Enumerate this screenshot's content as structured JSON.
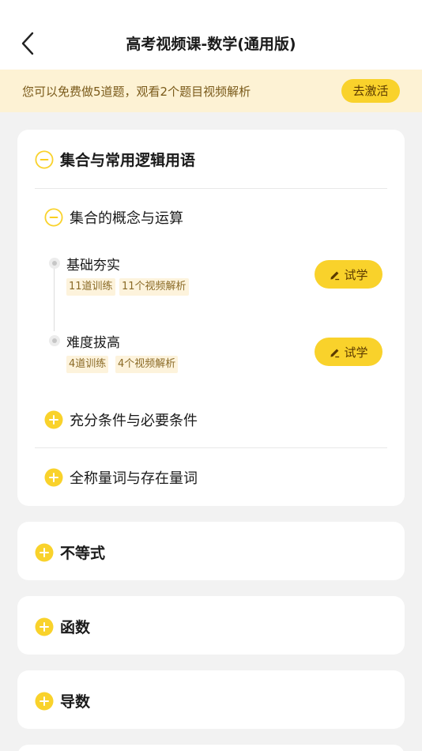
{
  "header": {
    "title": "高考视频课-数学(通用版)"
  },
  "banner": {
    "text": "您可以免费做5道题，观看2个题目视频解析",
    "button": "去激活"
  },
  "chapters": [
    {
      "title": "集合与常用逻辑用语",
      "expanded": true,
      "sections": [
        {
          "title": "集合的概念与运算",
          "expanded": true,
          "lessons": [
            {
              "title": "基础夯实",
              "tags": [
                "11道训练",
                "11个视频解析"
              ],
              "button": "试学"
            },
            {
              "title": "难度拔高",
              "tags": [
                "4道训练",
                "4个视频解析"
              ],
              "button": "试学"
            }
          ]
        },
        {
          "title": "充分条件与必要条件",
          "expanded": false
        },
        {
          "title": "全称量词与存在量词",
          "expanded": false
        }
      ]
    },
    {
      "title": "不等式",
      "expanded": false
    },
    {
      "title": "函数",
      "expanded": false
    },
    {
      "title": "导数",
      "expanded": false
    }
  ],
  "icons": {
    "back": "chevron-left-icon",
    "collapse": "minus-circle-icon",
    "expand": "plus-circle-icon",
    "try": "pencil-icon"
  },
  "colors": {
    "accent": "#f9d22b",
    "banner_bg": "#fdf2d4",
    "tag_bg": "#fdf3dc",
    "page_bg": "#f2f2f2"
  }
}
